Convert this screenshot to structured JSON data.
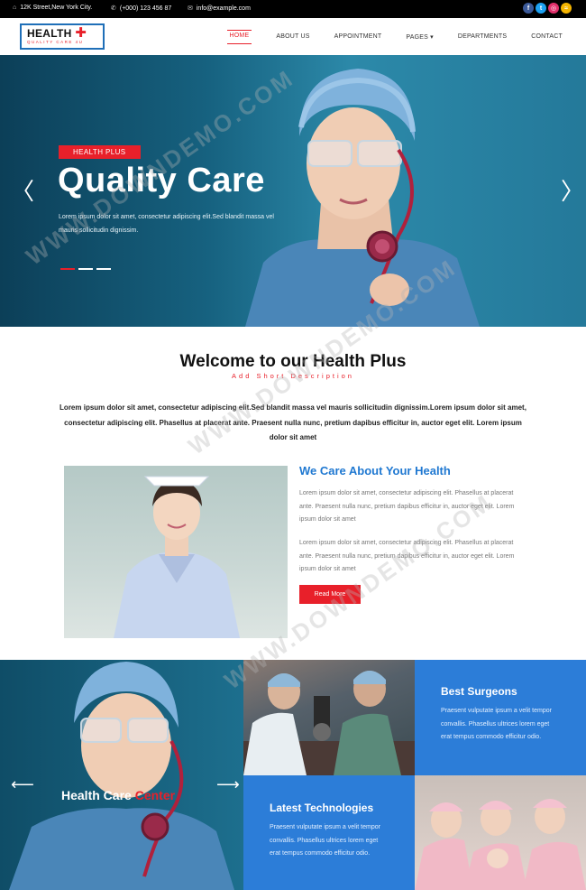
{
  "topbar": {
    "address": "12K Street,New York City.",
    "phone": "(+000) 123 456 87",
    "email": "info@example.com",
    "social": [
      {
        "icon": "facebook-icon",
        "glyph": "f",
        "color": "#3b5998"
      },
      {
        "icon": "twitter-icon",
        "glyph": "t",
        "color": "#1da1f2"
      },
      {
        "icon": "instagram-icon",
        "glyph": "◎",
        "color": "#e1306c"
      },
      {
        "icon": "rss-icon",
        "glyph": "≈",
        "color": "#f4b400"
      }
    ]
  },
  "logo": {
    "brand": "HEALTH",
    "cross": "✚",
    "tagline": "QUALITY CARE 4U"
  },
  "nav": {
    "items": [
      "HOME",
      "ABOUT US",
      "APPOINTMENT",
      "PAGES ▾",
      "DEPARTMENTS",
      "CONTACT"
    ],
    "active": "HOME"
  },
  "hero": {
    "badge": "HEALTH PLUS",
    "title": "Quality Care",
    "desc": "Lorem ipsum dolor sit amet, consectetur adipiscing elit.Sed blandit massa vel mauris sollicitudin dignissim.",
    "prev": "〈",
    "next": "〉"
  },
  "welcome": {
    "title": "Welcome to our Health Plus",
    "subtitle": "Add Short Description",
    "text": "Lorem ipsum dolor sit amet, consectetur adipiscing elit.Sed blandit massa vel mauris sollicitudin dignissim.Lorem ipsum dolor sit amet, consectetur adipiscing elit. Phasellus at placerat ante. Praesent nulla nunc, pretium dapibus efficitur in, auctor eget elit. Lorem ipsum dolor sit amet"
  },
  "care": {
    "title": "We Care About Your Health",
    "para1": "Lorem ipsum dolor sit amet, consectetur adipiscing elit. Phasellus at placerat ante. Praesent nulla nunc, pretium dapibus efficitur in, auctor eget elit. Lorem ipsum dolor sit amet",
    "para2": "Lorem ipsum dolor sit amet, consectetur adipiscing elit. Phasellus at placerat ante. Praesent nulla nunc, pretium dapibus efficitur in, auctor eget elit. Lorem ipsum dolor sit amet",
    "button": "Read More"
  },
  "bottom": {
    "slider_caption_white": "Health Care ",
    "slider_caption_red": "Center",
    "left_arrow": "⟵",
    "right_arrow": "⟶",
    "surgeons_title": "Best Surgeons",
    "surgeons_text": "Praesent vulputate ipsum a velit tempor convallis. Phasellus ultrices lorem eget erat tempus commodo efficitur odio.",
    "tech_title": "Latest Technologies",
    "tech_text": "Praesent vulputate ipsum a velit tempor convallis. Phasellus ultrices lorem eget erat tempus commodo efficitur odio."
  },
  "watermark": "WWW.DOWNDEMO.COM",
  "colors": {
    "accent": "#e8202a",
    "blue": "#2c7dd8",
    "dark_teal": "#0c3f58"
  }
}
